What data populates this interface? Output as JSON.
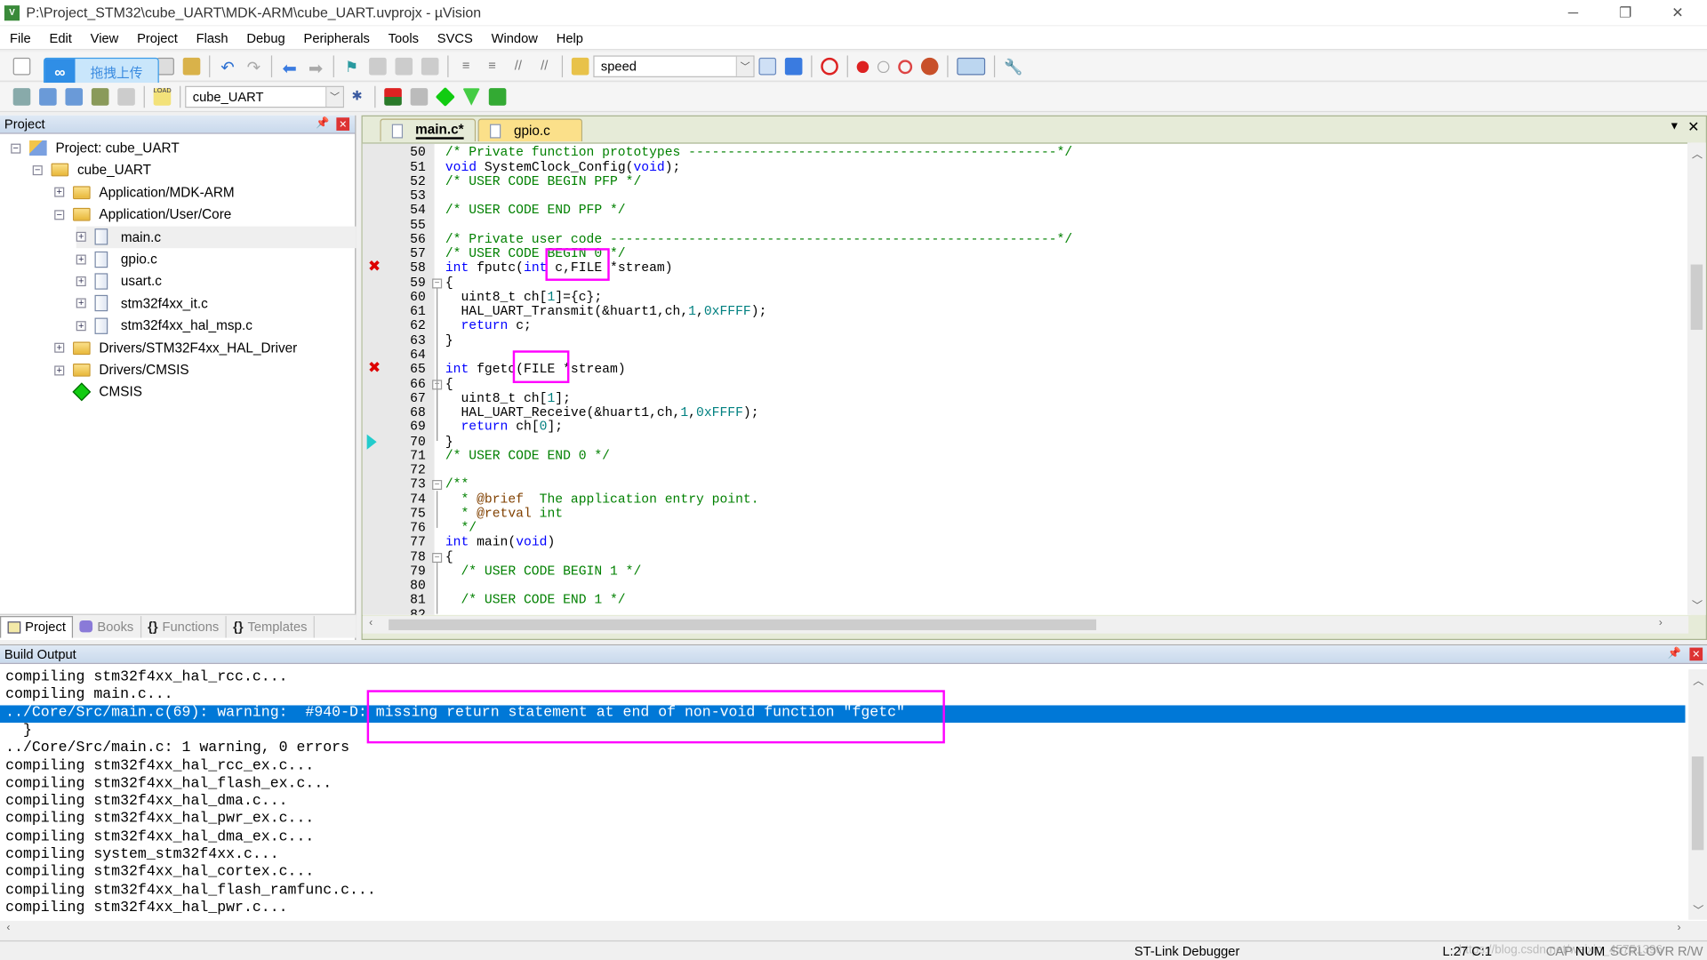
{
  "window": {
    "title": "P:\\Project_STM32\\cube_UART\\MDK-ARM\\cube_UART.uvprojx - µVision",
    "app_icon": "uv"
  },
  "menu": [
    "File",
    "Edit",
    "View",
    "Project",
    "Flash",
    "Debug",
    "Peripherals",
    "Tools",
    "SVCS",
    "Window",
    "Help"
  ],
  "toolbar": {
    "find_value": "speed",
    "target_value": "cube_UART",
    "upload_overlay": "拖拽上传",
    "load_label": "LOAD"
  },
  "project_panel": {
    "title": "Project",
    "tree": [
      {
        "label": "Project: cube_UART",
        "level": 0,
        "toggle": "−",
        "icon": "project"
      },
      {
        "label": "cube_UART",
        "level": 1,
        "toggle": "−",
        "icon": "folder-open"
      },
      {
        "label": "Application/MDK-ARM",
        "level": 2,
        "toggle": "+",
        "icon": "folder"
      },
      {
        "label": "Application/User/Core",
        "level": 2,
        "toggle": "−",
        "icon": "folder-open"
      },
      {
        "label": "main.c",
        "level": 3,
        "toggle": "+",
        "icon": "file",
        "selected": true
      },
      {
        "label": "gpio.c",
        "level": 3,
        "toggle": "+",
        "icon": "file"
      },
      {
        "label": "usart.c",
        "level": 3,
        "toggle": "+",
        "icon": "file"
      },
      {
        "label": "stm32f4xx_it.c",
        "level": 3,
        "toggle": "+",
        "icon": "file"
      },
      {
        "label": "stm32f4xx_hal_msp.c",
        "level": 3,
        "toggle": "+",
        "icon": "file"
      },
      {
        "label": "Drivers/STM32F4xx_HAL_Driver",
        "level": 2,
        "toggle": "+",
        "icon": "folder"
      },
      {
        "label": "Drivers/CMSIS",
        "level": 2,
        "toggle": "+",
        "icon": "folder"
      },
      {
        "label": "CMSIS",
        "level": 2,
        "toggle": "",
        "icon": "cmsis-diamond"
      }
    ],
    "tabs": [
      {
        "label": "Project",
        "active": true
      },
      {
        "label": "Books"
      },
      {
        "label": "Functions",
        "prefix": "{}"
      },
      {
        "label": "Templates",
        "prefix": "{}"
      }
    ]
  },
  "editor": {
    "tabs": [
      {
        "label": "main.c*",
        "active": true
      },
      {
        "label": "gpio.c"
      }
    ],
    "lines": [
      {
        "n": "50",
        "tokens": [
          {
            "t": "/* Private function prototypes -----------------------------------------------*/",
            "c": "cm"
          }
        ]
      },
      {
        "n": "51",
        "tokens": [
          {
            "t": "void",
            "c": "kw"
          },
          {
            "t": " SystemClock_Config("
          },
          {
            "t": "void",
            "c": "kw"
          },
          {
            "t": ");"
          }
        ]
      },
      {
        "n": "52",
        "tokens": [
          {
            "t": "/* USER CODE BEGIN PFP */",
            "c": "cm"
          }
        ]
      },
      {
        "n": "53",
        "tokens": []
      },
      {
        "n": "54",
        "tokens": [
          {
            "t": "/* USER CODE END PFP */",
            "c": "cm"
          }
        ]
      },
      {
        "n": "55",
        "tokens": []
      },
      {
        "n": "56",
        "tokens": [
          {
            "t": "/* Private user code ---------------------------------------------------------*/",
            "c": "cm"
          }
        ]
      },
      {
        "n": "57",
        "tokens": [
          {
            "t": "/* USER CODE BEGIN 0 */",
            "c": "cm"
          }
        ]
      },
      {
        "n": "58",
        "marker": "error",
        "tokens": [
          {
            "t": "int",
            "c": "kw"
          },
          {
            "t": " fputc("
          },
          {
            "t": "int",
            "c": "kw"
          },
          {
            "t": " c,FILE *stream)"
          }
        ]
      },
      {
        "n": "59",
        "fold": true,
        "tokens": [
          {
            "t": "{"
          }
        ]
      },
      {
        "n": "60",
        "tokens": [
          {
            "t": "  uint8_t ch["
          },
          {
            "t": "1",
            "c": "num"
          },
          {
            "t": "]={c};"
          }
        ]
      },
      {
        "n": "61",
        "tokens": [
          {
            "t": "  HAL_UART_Transmit(&huart1,ch,"
          },
          {
            "t": "1",
            "c": "num"
          },
          {
            "t": ","
          },
          {
            "t": "0xFFFF",
            "c": "num"
          },
          {
            "t": ");"
          }
        ]
      },
      {
        "n": "62",
        "tokens": [
          {
            "t": "  "
          },
          {
            "t": "return",
            "c": "kw"
          },
          {
            "t": " c;"
          }
        ]
      },
      {
        "n": "63",
        "tokens": [
          {
            "t": "}"
          }
        ]
      },
      {
        "n": "64",
        "tokens": []
      },
      {
        "n": "65",
        "marker": "error",
        "tokens": [
          {
            "t": "int",
            "c": "kw"
          },
          {
            "t": " fgetc(FILE *stream)"
          }
        ]
      },
      {
        "n": "66",
        "fold": true,
        "tokens": [
          {
            "t": "{"
          }
        ]
      },
      {
        "n": "67",
        "tokens": [
          {
            "t": "  uint8_t ch["
          },
          {
            "t": "1",
            "c": "num"
          },
          {
            "t": "];"
          }
        ]
      },
      {
        "n": "68",
        "tokens": [
          {
            "t": "  HAL_UART_Receive(&huart1,ch,"
          },
          {
            "t": "1",
            "c": "num"
          },
          {
            "t": ","
          },
          {
            "t": "0xFFFF",
            "c": "num"
          },
          {
            "t": ");"
          }
        ]
      },
      {
        "n": "69",
        "tokens": [
          {
            "t": "  "
          },
          {
            "t": "return",
            "c": "kw"
          },
          {
            "t": " ch["
          },
          {
            "t": "0",
            "c": "num"
          },
          {
            "t": "];"
          }
        ]
      },
      {
        "n": "70",
        "marker": "current",
        "tokens": [
          {
            "t": "}"
          }
        ]
      },
      {
        "n": "71",
        "tokens": [
          {
            "t": "/* USER CODE END 0 */",
            "c": "cm"
          }
        ]
      },
      {
        "n": "72",
        "tokens": []
      },
      {
        "n": "73",
        "fold": true,
        "tokens": [
          {
            "t": "/**",
            "c": "cm"
          }
        ]
      },
      {
        "n": "74",
        "tokens": [
          {
            "t": "  * ",
            "c": "cm"
          },
          {
            "t": "@brief",
            "c": "doc"
          },
          {
            "t": "  The application entry point.",
            "c": "cm"
          }
        ]
      },
      {
        "n": "75",
        "tokens": [
          {
            "t": "  * ",
            "c": "cm"
          },
          {
            "t": "@retval",
            "c": "doc"
          },
          {
            "t": " int",
            "c": "cm"
          }
        ]
      },
      {
        "n": "76",
        "tokens": [
          {
            "t": "  */",
            "c": "cm"
          }
        ]
      },
      {
        "n": "77",
        "tokens": [
          {
            "t": "int",
            "c": "kw"
          },
          {
            "t": " main("
          },
          {
            "t": "void",
            "c": "kw"
          },
          {
            "t": ")"
          }
        ]
      },
      {
        "n": "78",
        "fold": true,
        "tokens": [
          {
            "t": "{"
          }
        ]
      },
      {
        "n": "79",
        "tokens": [
          {
            "t": "  /* USER CODE BEGIN 1 */",
            "c": "cm"
          }
        ]
      },
      {
        "n": "80",
        "tokens": []
      },
      {
        "n": "81",
        "tokens": [
          {
            "t": "  /* USER CODE END 1 */",
            "c": "cm"
          }
        ]
      },
      {
        "n": "82",
        "tokens": []
      }
    ]
  },
  "build_output": {
    "title": "Build Output",
    "lines": [
      "compiling stm32f4xx_hal_rcc.c...",
      "compiling main.c...",
      "../Core/Src/main.c(69): warning:  #940-D: missing return statement at end of non-void function \"fgetc\"",
      "  }",
      "../Core/Src/main.c: 1 warning, 0 errors",
      "compiling stm32f4xx_hal_rcc_ex.c...",
      "compiling stm32f4xx_hal_flash_ex.c...",
      "compiling stm32f4xx_hal_dma.c...",
      "compiling stm32f4xx_hal_pwr_ex.c...",
      "compiling stm32f4xx_hal_dma_ex.c...",
      "compiling system_stm32f4xx.c...",
      "compiling stm32f4xx_hal_cortex.c...",
      "compiling stm32f4xx_hal_flash_ramfunc.c...",
      "compiling stm32f4xx_hal_pwr.c..."
    ],
    "selected_index": 2
  },
  "status": {
    "debugger": "ST-Link Debugger",
    "position": "L:27 C:1",
    "cap": "CAP",
    "num": "NUM",
    "scrl": "SCRL",
    "ovr": "OVR",
    "rw": "R/W",
    "watermark": "https://blog.csdn.net/weixin_45751396"
  },
  "colors": {
    "highlight_box": "#ff00ff",
    "selection": "#0078d7",
    "keyword": "#0000ff",
    "comment": "#008000",
    "number": "#008080"
  }
}
